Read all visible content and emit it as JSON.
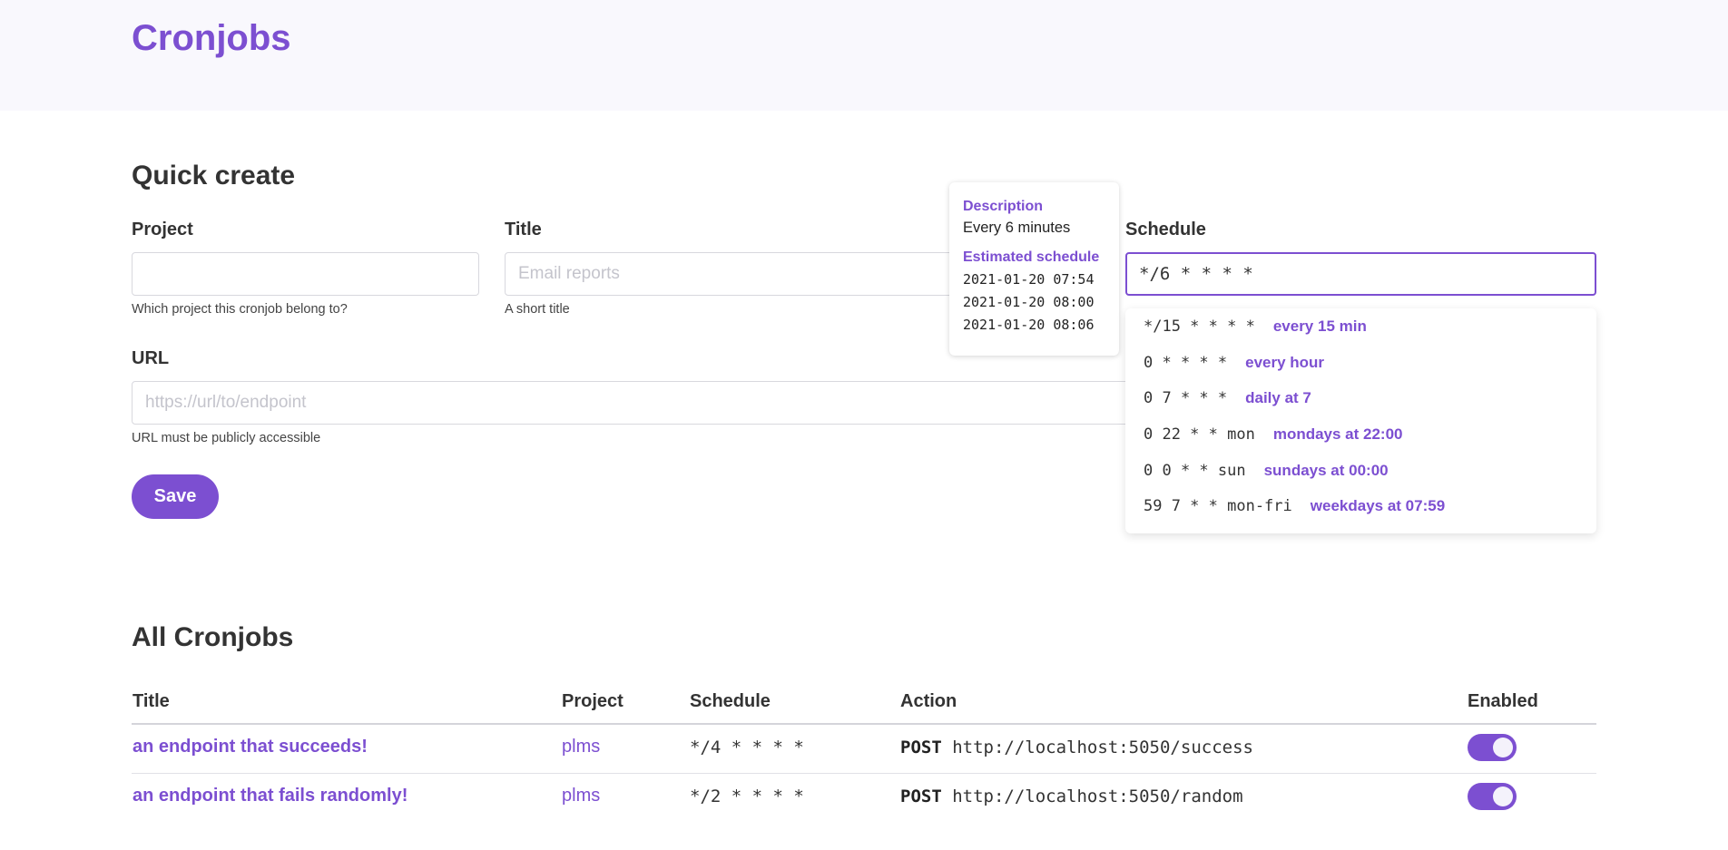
{
  "brand": "Cronjobs",
  "quick_create": {
    "heading": "Quick create",
    "project": {
      "label": "Project",
      "value": "",
      "placeholder": "",
      "help": "Which project this cronjob belong to?"
    },
    "title": {
      "label": "Title",
      "value": "",
      "placeholder": "Email reports",
      "help": "A short title"
    },
    "schedule": {
      "label": "Schedule",
      "value": "*/6 * * * *"
    },
    "url": {
      "label": "URL",
      "value": "",
      "placeholder": "https://url/to/endpoint",
      "help": "URL must be publicly accessible"
    },
    "save_label": "Save"
  },
  "schedule_tooltip": {
    "description_heading": "Description",
    "description": "Every 6 minutes",
    "estimated_heading": "Estimated schedule",
    "estimated": [
      "2021-01-20 07:54",
      "2021-01-20 08:00",
      "2021-01-20 08:06"
    ]
  },
  "schedule_suggestions": [
    {
      "expr": "*/15 * * * *",
      "desc": "every 15 min"
    },
    {
      "expr": "0 * * * *",
      "desc": "every hour"
    },
    {
      "expr": "0 7 * * *",
      "desc": "daily at 7"
    },
    {
      "expr": "0 22 * * mon",
      "desc": "mondays at 22:00"
    },
    {
      "expr": "0 0 * * sun",
      "desc": "sundays at 00:00"
    },
    {
      "expr": "59 7 * * mon-fri",
      "desc": "weekdays at 07:59"
    }
  ],
  "all_cronjobs": {
    "heading": "All Cronjobs",
    "columns": [
      "Title",
      "Project",
      "Schedule",
      "Action",
      "Enabled"
    ],
    "rows": [
      {
        "title": "an endpoint that succeeds!",
        "project": "plms",
        "schedule": "*/4 * * * *",
        "method": "POST",
        "url": "http://localhost:5050/success",
        "enabled": true
      },
      {
        "title": "an endpoint that fails randomly!",
        "project": "plms",
        "schedule": "*/2 * * * *",
        "method": "POST",
        "url": "http://localhost:5050/random",
        "enabled": true
      }
    ]
  },
  "colors": {
    "accent": "#7c4fd1",
    "header_bg": "#f9f8fd"
  }
}
